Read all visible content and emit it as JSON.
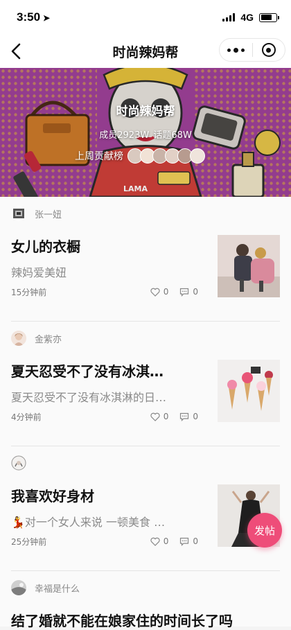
{
  "status_bar": {
    "time": "3:50",
    "network": "4G"
  },
  "nav": {
    "title": "时尚辣妈帮"
  },
  "banner": {
    "title": "时尚辣妈帮",
    "members": "成员2923W",
    "topics": "话题68W",
    "contributors_label": "上周贡献榜"
  },
  "posts": [
    {
      "author": "张一妞",
      "title": "女儿的衣橱",
      "excerpt": "辣妈爱美妞",
      "time": "15分钟前",
      "likes": "0",
      "comments": "0"
    },
    {
      "author": "金紫亦",
      "title": "夏天忍受不了没有冰淇…",
      "excerpt": "夏天忍受不了没有冰淇淋的日…",
      "time": "4分钟前",
      "likes": "0",
      "comments": "0"
    },
    {
      "author": "",
      "title": "我喜欢好身材",
      "excerpt": "💃对一个女人来说 一顿美食 …",
      "time": "25分钟前",
      "likes": "0",
      "comments": "0"
    },
    {
      "author": "幸福是什么",
      "title": "结了婚就不能在娘家住的时间长了吗"
    }
  ],
  "fab": {
    "label": "发帖"
  },
  "colors": {
    "accent": "#ee4d79",
    "banner": "#a0429b"
  }
}
